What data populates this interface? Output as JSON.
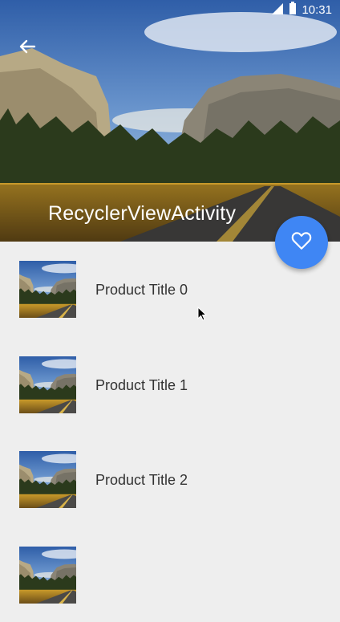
{
  "status_bar": {
    "time": "10:31",
    "icons": [
      "signal-icon",
      "battery-icon"
    ]
  },
  "toolbar": {
    "title": "RecyclerViewActivity",
    "back_icon": "arrow-back-icon"
  },
  "fab": {
    "icon": "heart-outline-icon",
    "color": "#3f86f4"
  },
  "products": [
    {
      "title": "Product Title 0"
    },
    {
      "title": "Product Title 1"
    },
    {
      "title": "Product Title 2"
    },
    {
      "title": ""
    }
  ],
  "colors": {
    "background": "#eeeeee",
    "accent": "#3f86f4"
  }
}
